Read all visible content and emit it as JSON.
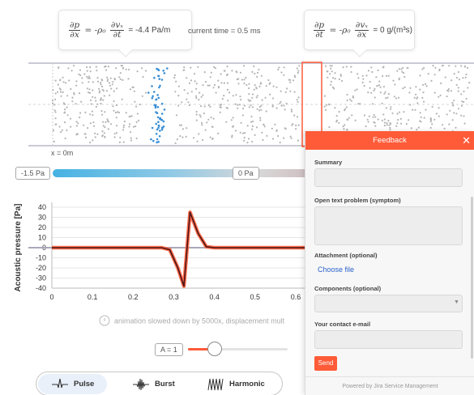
{
  "left_formula": {
    "lhs_num": "∂p",
    "lhs_den": "∂x",
    "mid": "= -ρ₀",
    "rhs_num": "∂vₓ",
    "rhs_den": "∂t",
    "value": "= -4.4 Pa/m"
  },
  "right_formula": {
    "lhs_num": "∂p",
    "lhs_den": "∂t",
    "mid": "= -ρ₀",
    "rhs_num": "∂vₓ",
    "rhs_den": "∂x",
    "value": "= 0 g/(m³s)"
  },
  "current_time": "current time = 0.5 ms",
  "x_origin_label": "x = 0m",
  "pressure_scale": {
    "min_label": "-1.5 Pa",
    "current_label": "0 Pa"
  },
  "colors": {
    "accent": "#ff5b38",
    "particle": "#b4b4b4",
    "particle_highlight": "#3a8fd6",
    "curve_dark": "#4a1516",
    "curve_red": "#ff5b38",
    "scale_low": "#46b2e3",
    "link": "#2a62c9"
  },
  "chart_data": {
    "type": "line",
    "title": "",
    "xlabel": "",
    "ylabel": "Acoustic pressure [Pa]",
    "xlim": [
      0,
      0.63
    ],
    "ylim": [
      -40,
      40
    ],
    "x_ticks": [
      "0",
      "0.1",
      "0.2",
      "0.3",
      "0.4",
      "0.5",
      "0.6"
    ],
    "y_ticks": [
      "40",
      "30",
      "20",
      "10",
      "0",
      "-10",
      "-20",
      "-30",
      "-40"
    ],
    "grid": "horizontal",
    "series": [
      {
        "x": [
          0,
          0.27,
          0.29,
          0.31,
          0.325,
          0.34,
          0.36,
          0.38,
          0.4,
          0.63
        ],
        "y": [
          0,
          0,
          -2,
          -20,
          -38,
          35,
          14,
          1,
          0,
          0
        ]
      }
    ]
  },
  "note_text": "animation slowed down by 5000x, displacement mult",
  "amplitude": {
    "label": "A = 1",
    "value_fraction": 0.28
  },
  "modes": [
    {
      "label": "Pulse",
      "icon": "pulse-icon",
      "active": true
    },
    {
      "label": "Burst",
      "icon": "burst-icon",
      "active": false
    },
    {
      "label": "Harmonic",
      "icon": "harmonic-icon",
      "active": false
    }
  ],
  "feedback": {
    "title": "Feedback",
    "close": "✕",
    "summary_label": "Summary",
    "summary_value": "",
    "problem_label": "Open text problem (symptom)",
    "problem_value": "",
    "attachment_label": "Attachment (optional)",
    "choose_file": "Choose file",
    "components_label": "Components (optional)",
    "components_value": "",
    "email_label": "Your contact e-mail",
    "email_value": "",
    "send": "Send",
    "footer": "Powered by Jira Service Management"
  }
}
